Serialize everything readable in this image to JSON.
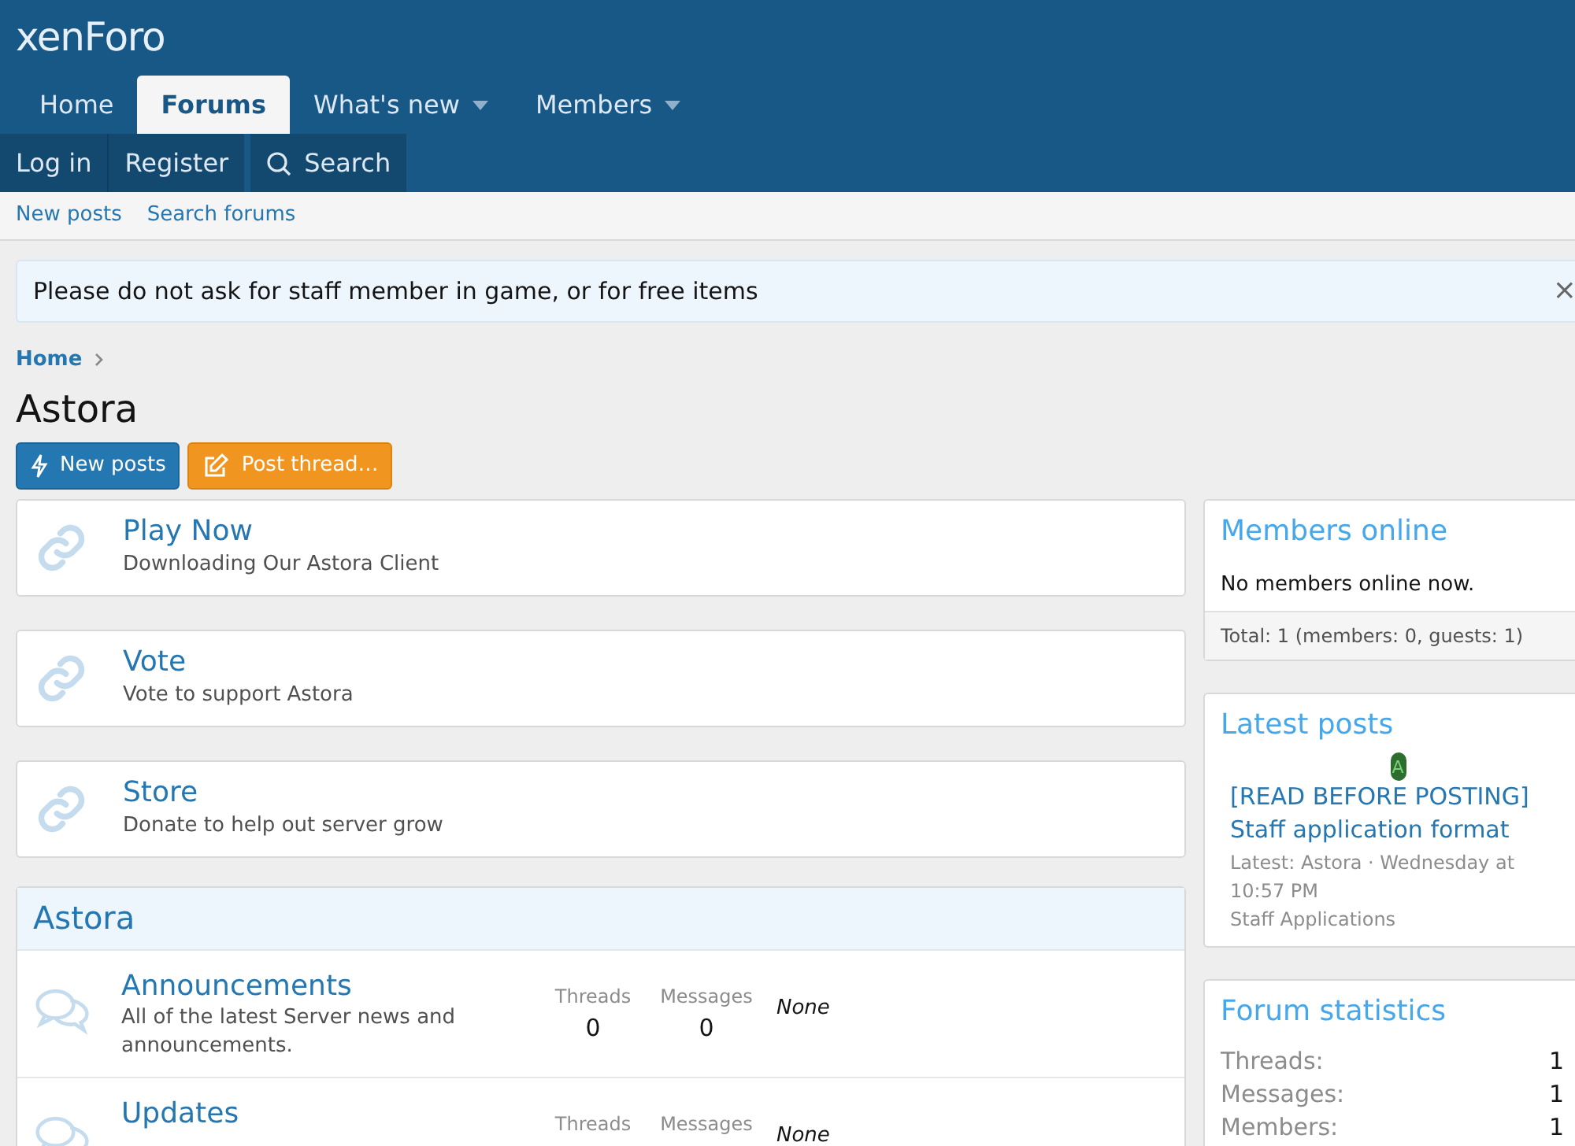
{
  "logo": "xenForo",
  "nav_tabs": [
    {
      "label": "Home",
      "selected": false,
      "dropdown": false
    },
    {
      "label": "Forums",
      "selected": true,
      "dropdown": false
    },
    {
      "label": "What's new",
      "selected": false,
      "dropdown": true
    },
    {
      "label": "Members",
      "selected": false,
      "dropdown": true
    }
  ],
  "account_bar": [
    {
      "label": "Log in",
      "kind": "text"
    },
    {
      "label": "Register",
      "kind": "text"
    },
    {
      "label": "Search",
      "kind": "search"
    }
  ],
  "sub_nav": [
    "New posts",
    "Search forums"
  ],
  "notice": {
    "text": "Please do not ask for staff member in game, or for free items",
    "close": "×"
  },
  "breadcrumb": [
    "Home"
  ],
  "page_title": "Astora",
  "actions": [
    {
      "label": "New posts",
      "kind": "new"
    },
    {
      "label": "Post thread…",
      "kind": "post"
    }
  ],
  "link_forums": [
    {
      "title": "Play Now",
      "description": "Downloading Our Astora Client"
    },
    {
      "title": "Vote",
      "description": "Vote to support Astora"
    },
    {
      "title": "Store",
      "description": "Donate to help out server grow"
    }
  ],
  "category": {
    "title": "Astora",
    "forums": [
      {
        "title": "Announcements",
        "description": "All of the latest Server news and announcements.",
        "threads_label": "Threads",
        "threads": "0",
        "messages_label": "Messages",
        "messages": "0",
        "latest": "None"
      },
      {
        "title": "Updates",
        "threads_label": "Threads",
        "messages_label": "Messages",
        "latest": "None"
      }
    ]
  },
  "members_online": {
    "title": "Members online",
    "body": "No members online now.",
    "footer": "Total: 1 (members: 0, guests: 1)"
  },
  "latest_posts": {
    "title": "Latest posts",
    "posts": [
      {
        "avatar": "A",
        "title": "[READ BEFORE POSTING] Staff application format",
        "meta": "Latest: Astora · Wednesday at 10:57 PM",
        "forum": "Staff Applications"
      }
    ]
  },
  "forum_statistics": {
    "title": "Forum statistics",
    "rows": [
      {
        "label": "Threads:",
        "value": "1"
      },
      {
        "label": "Messages:",
        "value": "1"
      },
      {
        "label": "Members:",
        "value": "1"
      }
    ]
  }
}
